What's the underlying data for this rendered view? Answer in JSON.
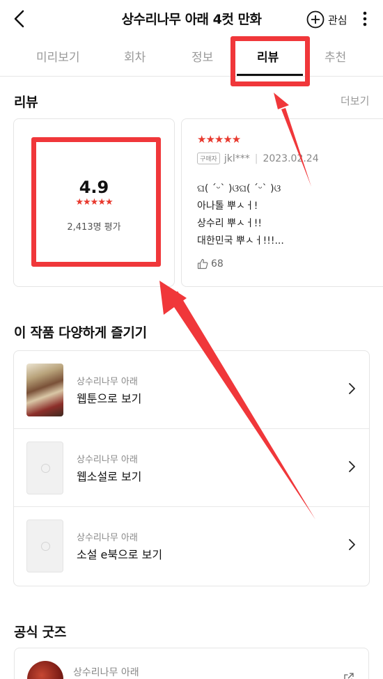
{
  "header": {
    "title": "상수리나무 아래 4컷 만화",
    "favorite_label": "관심"
  },
  "tabs": [
    {
      "label": "미리보기"
    },
    {
      "label": "회차"
    },
    {
      "label": "정보"
    },
    {
      "label": "리뷰"
    },
    {
      "label": "추천"
    }
  ],
  "active_tab": "리뷰",
  "review_section": {
    "title": "리뷰",
    "more_label": "더보기",
    "summary": {
      "rating": "4.9",
      "stars": "★★★★★",
      "count_text": "2,413명 평가"
    },
    "review": {
      "stars": "★★★★★",
      "badge": "구매자",
      "user": "jkl***",
      "date": "2023.02.24",
      "lines": [
        "ଘ( ˊᵕˋ )ଓଘ( ˊᵕˋ )ଓ",
        "아나톨 뿌ㅅㅓ!",
        "상수리 뿌ㅅㅓ!!",
        "대한민국 뿌ㅅㅓ!!!..."
      ],
      "likes": "68"
    }
  },
  "enjoy_section": {
    "title": "이 작품 다양하게 즐기기",
    "items": [
      {
        "series": "상수리나무 아래",
        "label": "웹툰으로 보기"
      },
      {
        "series": "상수리나무 아래",
        "label": "웹소설로 보기"
      },
      {
        "series": "상수리나무 아래",
        "label": "소설 e북으로 보기"
      }
    ]
  },
  "goods_section": {
    "title": "공식 굿즈",
    "item_series": "상수리나무 아래"
  },
  "colors": {
    "accent_red": "#e8392e",
    "annotation_red": "#f0373a"
  }
}
